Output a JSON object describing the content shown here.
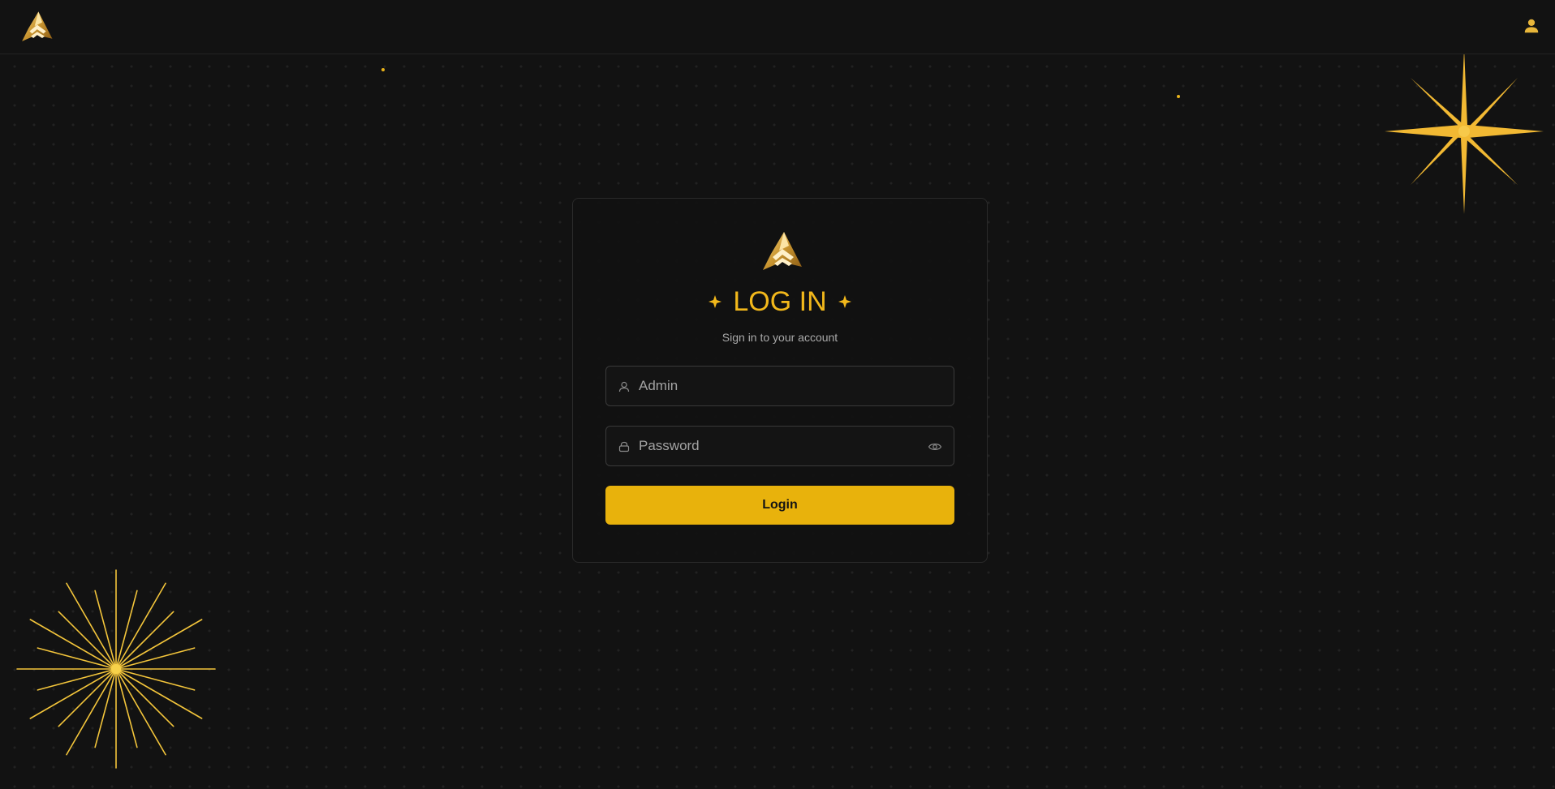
{
  "header": {
    "logo_icon": "app-logo-icon",
    "user_icon": "user-icon"
  },
  "login": {
    "title": "LOG IN",
    "subtitle": "Sign in to your account",
    "username": {
      "value": "",
      "placeholder": "Admin",
      "icon": "user-outline-icon"
    },
    "password": {
      "value": "",
      "placeholder": "Password",
      "icon": "lock-icon",
      "toggle_icon": "eye-icon"
    },
    "submit_label": "Login"
  },
  "colors": {
    "background": "#121212",
    "accent": "#f2b81b",
    "button": "#e8b20c",
    "border": "#3a3a3a",
    "muted_text": "#a9a9a9"
  }
}
